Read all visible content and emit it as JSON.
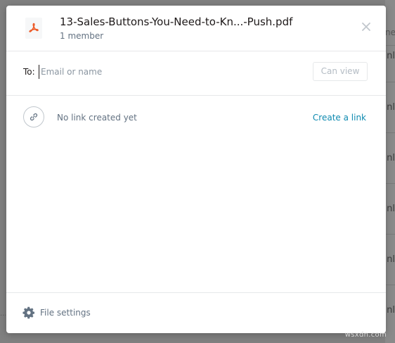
{
  "background": {
    "right_column_cells": [
      "ne",
      "nl",
      "nl",
      "nl",
      "nl",
      "nl",
      "nl"
    ],
    "watermark": "wsxdn.com"
  },
  "modal": {
    "file": {
      "name": "13-Sales-Buttons-You-Need-to-Kn...-Push.pdf",
      "members": "1 member",
      "icon": "pdf-icon",
      "icon_color": "#ed5c2a"
    },
    "close_icon": "close-icon",
    "to": {
      "label": "To:",
      "placeholder": "Email or name",
      "value": "",
      "permission_label": "Can view"
    },
    "link": {
      "status": "No link created yet",
      "action": "Create a link",
      "action_color": "#0e8ab0"
    },
    "footer": {
      "settings_label": "File settings"
    }
  }
}
